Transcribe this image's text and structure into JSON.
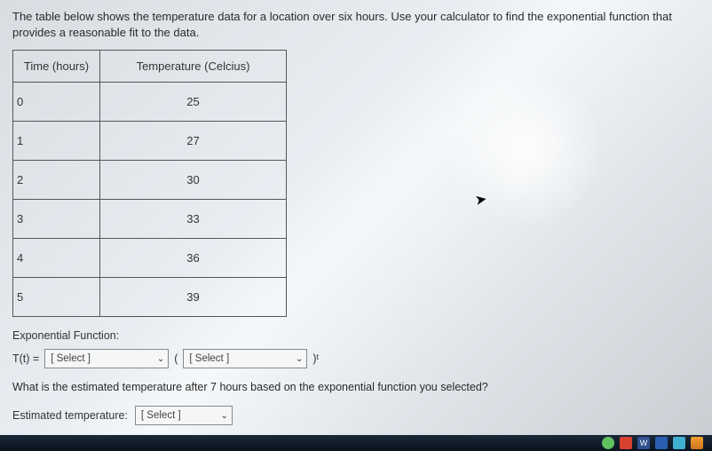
{
  "intro": "The table below shows the temperature data for a location over six hours. Use your calculator to find the exponential function that provides a reasonable fit to the data.",
  "table": {
    "headers": {
      "time": "Time (hours)",
      "temp": "Temperature (Celcius)"
    },
    "rows": [
      {
        "time": "0",
        "temp": "25"
      },
      {
        "time": "1",
        "temp": "27"
      },
      {
        "time": "2",
        "temp": "30"
      },
      {
        "time": "3",
        "temp": "33"
      },
      {
        "time": "4",
        "temp": "36"
      },
      {
        "time": "5",
        "temp": "39"
      }
    ]
  },
  "exp_label": "Exponential Function:",
  "func": {
    "lhs": "T(t) =",
    "select1": "[ Select ]",
    "paren_open": "(",
    "select2": "[ Select ]",
    "tail": ")ᵗ"
  },
  "question": "What is the estimated temperature after 7 hours based on the exponential function you selected?",
  "estimate": {
    "label": "Estimated temperature:",
    "select": "[ Select ]"
  },
  "taskbar": {
    "w": "W"
  }
}
